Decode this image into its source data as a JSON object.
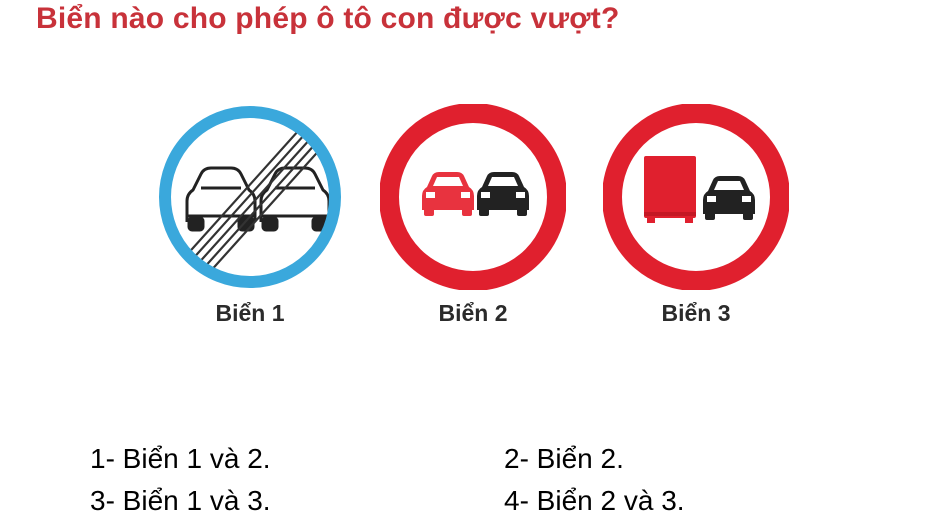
{
  "question": "Biển nào cho phép ô tô con được vượt?",
  "signs": [
    {
      "label": "Biển 1",
      "icon": "end-of-no-overtaking-sign-icon"
    },
    {
      "label": "Biển 2",
      "icon": "no-overtaking-sign-icon"
    },
    {
      "label": "Biển 3",
      "icon": "no-overtaking-for-trucks-sign-icon"
    }
  ],
  "answers": [
    {
      "text": "1- Biển 1 và 2."
    },
    {
      "text": "2- Biển 2."
    },
    {
      "text": "3- Biển 1 và 3."
    },
    {
      "text": "4- Biển 2 và 3."
    }
  ],
  "colors": {
    "question": "#c8323a",
    "sign_blue": "#3aa8dc",
    "sign_red": "#e0202e",
    "car_red": "#e8333f",
    "car_black": "#222222",
    "truck_red": "#e0202e"
  }
}
